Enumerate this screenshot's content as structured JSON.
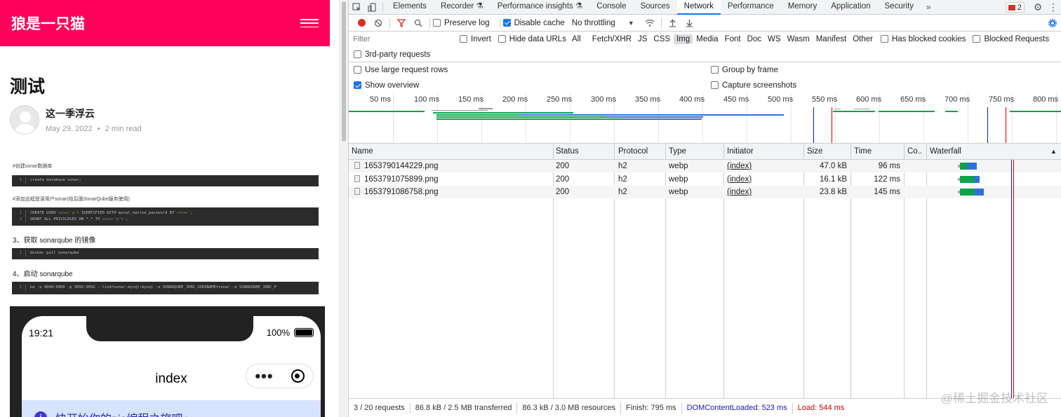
{
  "left": {
    "site_title": "狼是一只猫",
    "post_title": "测试",
    "author_name": "这一季浮云",
    "post_date": "May 29, 2022",
    "read_time": "2 min read",
    "meta_separator": "•",
    "note1": "#创建sonar数据库",
    "code1": [
      {
        "n": "1",
        "text": "create database sonar;"
      }
    ],
    "note2": "#添加远程登录用户sonar(给后面SonarQube服务使用)",
    "code2": [
      {
        "n": "1",
        "pre": "CREATE USER ",
        "str": "'sonar'@'%'",
        "post": " IDENTIFIED WITH mysql_native_password BY ",
        "str2": "'sonar'",
        "end": ";"
      },
      {
        "n": "2",
        "pre": "GRANT ALL PRIVILEGES ON *.* TO ",
        "str": "'sonar'@'%'",
        "post": ";",
        "str2": "",
        "end": ""
      }
    ],
    "heading3": "3、获取 sonarqube 的镜像",
    "code3": [
      {
        "n": "1",
        "text": "docker pull sonarqube"
      }
    ],
    "heading4": "4、启动 sonarqube",
    "code4": [
      {
        "n": "1",
        "text": "be -p 9000:9000 -p 9092:9092 --link=sonar-mysql:mysql -e SONARQUBE_JDBC_USERNAME=sonar -e SONARQUBE_JDBC_P"
      }
    ],
    "phone": {
      "time": "19:21",
      "battery": "100%",
      "title": "index",
      "capsule_dots": "•••",
      "notice": "快开始你的pie编程之旅吧～",
      "notice_icon": "i"
    }
  },
  "devtools": {
    "tabs": [
      {
        "label": "Elements",
        "active": false
      },
      {
        "label": "Recorder ⚗",
        "active": false
      },
      {
        "label": "Performance insights ⚗",
        "active": false
      },
      {
        "label": "Console",
        "active": false
      },
      {
        "label": "Sources",
        "active": false
      },
      {
        "label": "Network",
        "active": true
      },
      {
        "label": "Performance",
        "active": false
      },
      {
        "label": "Memory",
        "active": false
      },
      {
        "label": "Application",
        "active": false
      },
      {
        "label": "Security",
        "active": false
      }
    ],
    "tab_more": "»",
    "error_count": "2",
    "toolbar": {
      "preserve_log": "Preserve log",
      "preserve_log_checked": false,
      "disable_cache": "Disable cache",
      "disable_cache_checked": true,
      "throttling": "No throttling"
    },
    "filter": {
      "placeholder": "Filter",
      "invert": "Invert",
      "hide_data_urls": "Hide data URLs",
      "types": [
        {
          "label": "All",
          "active": false
        },
        {
          "label": "Fetch/XHR",
          "active": false
        },
        {
          "label": "JS",
          "active": false
        },
        {
          "label": "CSS",
          "active": false
        },
        {
          "label": "Img",
          "active": true
        },
        {
          "label": "Media",
          "active": false
        },
        {
          "label": "Font",
          "active": false
        },
        {
          "label": "Doc",
          "active": false
        },
        {
          "label": "WS",
          "active": false
        },
        {
          "label": "Wasm",
          "active": false
        },
        {
          "label": "Manifest",
          "active": false
        },
        {
          "label": "Other",
          "active": false
        }
      ],
      "has_blocked_cookies": "Has blocked cookies",
      "blocked_requests": "Blocked Requests",
      "third_party": "3rd-party requests"
    },
    "options": {
      "large_rows": "Use large request rows",
      "large_rows_checked": false,
      "group_by_frame": "Group by frame",
      "group_by_frame_checked": false,
      "show_overview": "Show overview",
      "show_overview_checked": true,
      "capture_screenshots": "Capture screenshots",
      "capture_screenshots_checked": false
    },
    "overview_ticks": [
      "50 ms",
      "100 ms",
      "150 ms",
      "200 ms",
      "250 ms",
      "300 ms",
      "350 ms",
      "400 ms",
      "450 ms",
      "500 ms",
      "550 ms",
      "600 ms",
      "650 ms",
      "700 ms",
      "750 ms",
      "800 ms"
    ],
    "columns": {
      "name": "Name",
      "status": "Status",
      "protocol": "Protocol",
      "type": "Type",
      "initiator": "Initiator",
      "size": "Size",
      "time": "Time",
      "co": "Co..",
      "waterfall": "Waterfall",
      "sort_indicator": "▲"
    },
    "rows": [
      {
        "name": "1653790144229.png",
        "status": "200",
        "protocol": "h2",
        "type": "webp",
        "initiator": "(index)",
        "size": "47.0 kB",
        "time": "96 ms"
      },
      {
        "name": "1653791075899.png",
        "status": "200",
        "protocol": "h2",
        "type": "webp",
        "initiator": "(index)",
        "size": "16.1 kB",
        "time": "122 ms"
      },
      {
        "name": "1653791086758.png",
        "status": "200",
        "protocol": "h2",
        "type": "webp",
        "initiator": "(index)",
        "size": "23.8 kB",
        "time": "145 ms"
      }
    ],
    "status_bar": {
      "requests": "3 / 20 requests",
      "transferred": "86.8 kB / 2.5 MB transferred",
      "resources": "86.3 kB / 3.0 MB resources",
      "finish": "Finish: 795 ms",
      "dom_content_loaded": "DOMContentLoaded: 523 ms",
      "load": "Load: 544 ms"
    },
    "colors": {
      "dcl": "#1a1aa6",
      "load": "#c80000",
      "waiting": "#0ba34a",
      "download": "#2f70d8"
    }
  },
  "watermark": "@稀土掘金技术社区"
}
